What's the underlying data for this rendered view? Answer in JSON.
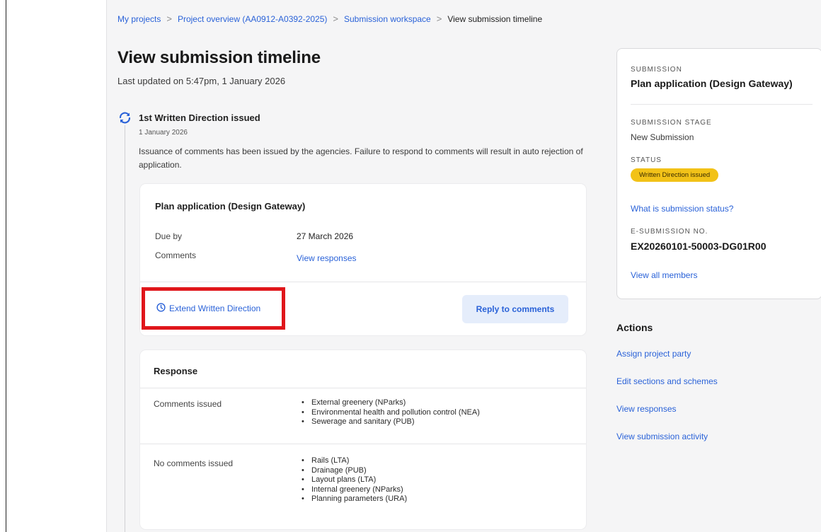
{
  "breadcrumb": {
    "items": [
      "My projects",
      "Project overview (AA0912-A0392-2025)",
      "Submission workspace"
    ],
    "current": "View submission timeline",
    "separator": ">"
  },
  "page": {
    "title": "View submission timeline",
    "last_updated": "Last updated on 5:47pm, 1 January 2026"
  },
  "timeline": {
    "event": {
      "icon": "refresh-icon",
      "title": "1st Written Direction issued",
      "date": "1 January 2026",
      "description": "Issuance of comments has been issued by the agencies. Failure to respond to comments will result in auto rejection of application."
    }
  },
  "plan_card": {
    "title": "Plan application (Design Gateway)",
    "due_label": "Due by",
    "due_value": "27 March 2026",
    "comments_label": "Comments",
    "comments_link": "View responses",
    "extend_label": "Extend Written Direction",
    "extend_icon": "clock-icon",
    "reply_button": "Reply to comments"
  },
  "response_card": {
    "title": "Response",
    "comments_issued_label": "Comments issued",
    "comments_issued": [
      "External greenery (NParks)",
      "Environmental health and pollution control (NEA)",
      "Sewerage and sanitary (PUB)"
    ],
    "no_comments_label": "No comments issued",
    "no_comments": [
      "Rails (LTA)",
      "Drainage (PUB)",
      "Layout plans (LTA)",
      "Internal greenery (NParks)",
      "Planning parameters (URA)"
    ]
  },
  "sidebar": {
    "submission_caption": "SUBMISSION",
    "submission_name": "Plan application (Design Gateway)",
    "stage_caption": "SUBMISSION STAGE",
    "stage_value": "New Submission",
    "status_caption": "STATUS",
    "status_badge": "Written Direction issued",
    "status_help_link": "What is submission status?",
    "esub_caption": "E-SUBMISSION NO.",
    "esub_value": "EX20260101-50003-DG01R00",
    "members_link": "View all members"
  },
  "actions": {
    "heading": "Actions",
    "items": [
      "Assign project party",
      "Edit sections and schemes",
      "View responses",
      "View submission activity"
    ]
  },
  "colors": {
    "link": "#2a62d8",
    "badge": "#f2c218",
    "highlight": "#e0161b",
    "background": "#f5f5f6"
  }
}
